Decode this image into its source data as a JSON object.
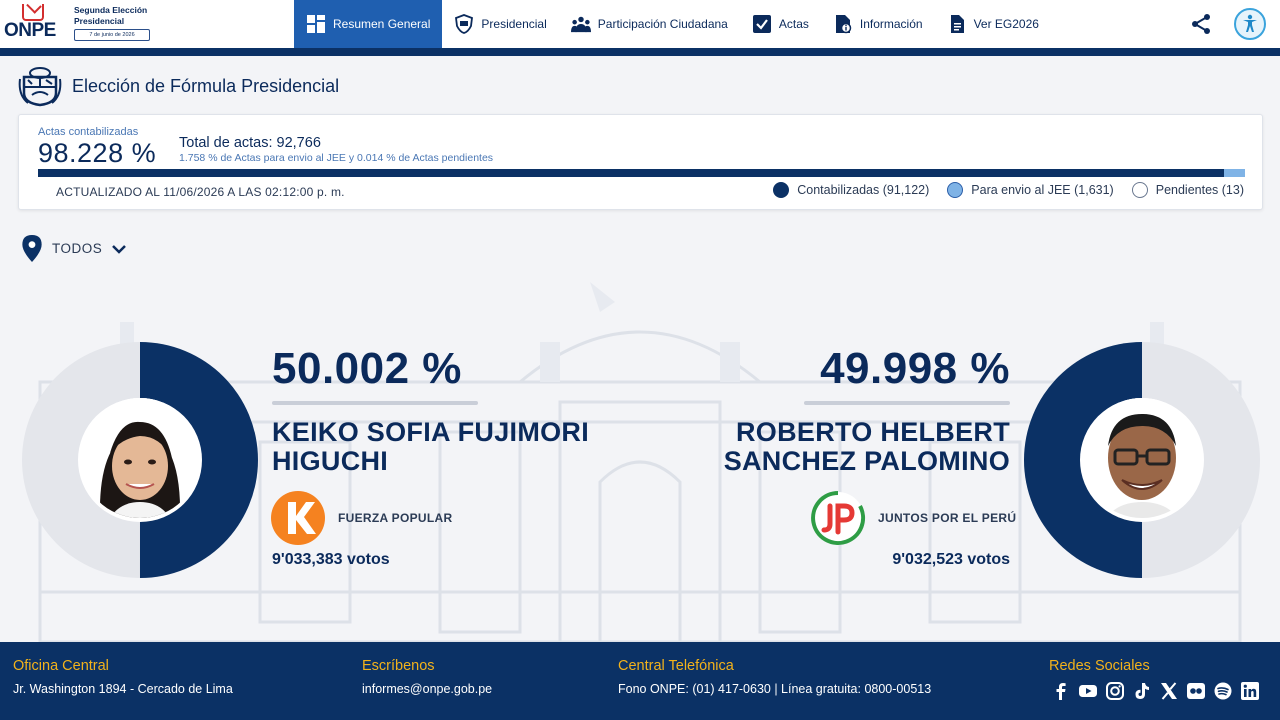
{
  "header": {
    "logo_text": "ONPE",
    "election_title": "Segunda Elección Presidencial",
    "election_date": "7 de junio de 2026",
    "nav": [
      {
        "label": "Resumen General",
        "icon": "dashboard-icon",
        "active": true
      },
      {
        "label": "Presidencial",
        "icon": "shield-icon",
        "active": false
      },
      {
        "label": "Participación Ciudadana",
        "icon": "people-icon",
        "active": false
      },
      {
        "label": "Actas",
        "icon": "checkbox-icon",
        "active": false
      },
      {
        "label": "Información",
        "icon": "info-doc-icon",
        "active": false
      },
      {
        "label": "Ver EG2026",
        "icon": "document-icon",
        "active": false
      }
    ]
  },
  "page": {
    "title": "Elección de Fórmula Presidencial"
  },
  "summary": {
    "actas_label": "Actas contabilizadas",
    "actas_pct": "98.228 %",
    "total_label": "Total de actas: 92,766",
    "sub_label": "1.758 % de Actas para envio al JEE y 0.014 % de Actas pendientes",
    "progress": {
      "contabilizadas_pct": 98.228,
      "jee_pct": 1.758,
      "pendientes_pct": 0.014
    },
    "updated": "ACTUALIZADO AL 11/06/2026 A LAS 02:12:00 p. m.",
    "legend": [
      {
        "label": "Contabilizadas (91,122)",
        "color": "#0b3165"
      },
      {
        "label": "Para envio al JEE (1,631)",
        "color": "#7fb3e6"
      },
      {
        "label": "Pendientes (13)",
        "color": "#ffffff"
      }
    ]
  },
  "filter": {
    "region": "TODOS"
  },
  "candidates": [
    {
      "pct_text": "50.002 %",
      "pct_value": 50.002,
      "name": "KEIKO SOFIA FUJIMORI HIGUCHI",
      "party": "FUERZA POPULAR",
      "party_color": "#f58220",
      "votes": "9'033,383 votos"
    },
    {
      "pct_text": "49.998 %",
      "pct_value": 49.998,
      "name": "ROBERTO HELBERT SANCHEZ PALOMINO",
      "party": "JUNTOS POR EL PERÚ",
      "party_color": "#e53935",
      "votes": "9'032,523 votos"
    }
  ],
  "footer": {
    "office_title": "Oficina Central",
    "office_value": "Jr. Washington 1894 - Cercado de Lima",
    "email_title": "Escríbenos",
    "email_value": "informes@onpe.gob.pe",
    "phone_title": "Central Telefónica",
    "phone_value": "Fono ONPE: (01) 417-0630 | Línea gratuita: 0800-00513",
    "social_title": "Redes Sociales",
    "social": [
      "facebook-icon",
      "youtube-icon",
      "instagram-icon",
      "tiktok-icon",
      "x-icon",
      "flickr-icon",
      "spotify-icon",
      "linkedin-icon"
    ]
  },
  "colors": {
    "primary": "#0b3165",
    "nav_active": "#1f5fb0",
    "accent_yellow": "#f2b21b",
    "jee": "#7fb3e6"
  }
}
